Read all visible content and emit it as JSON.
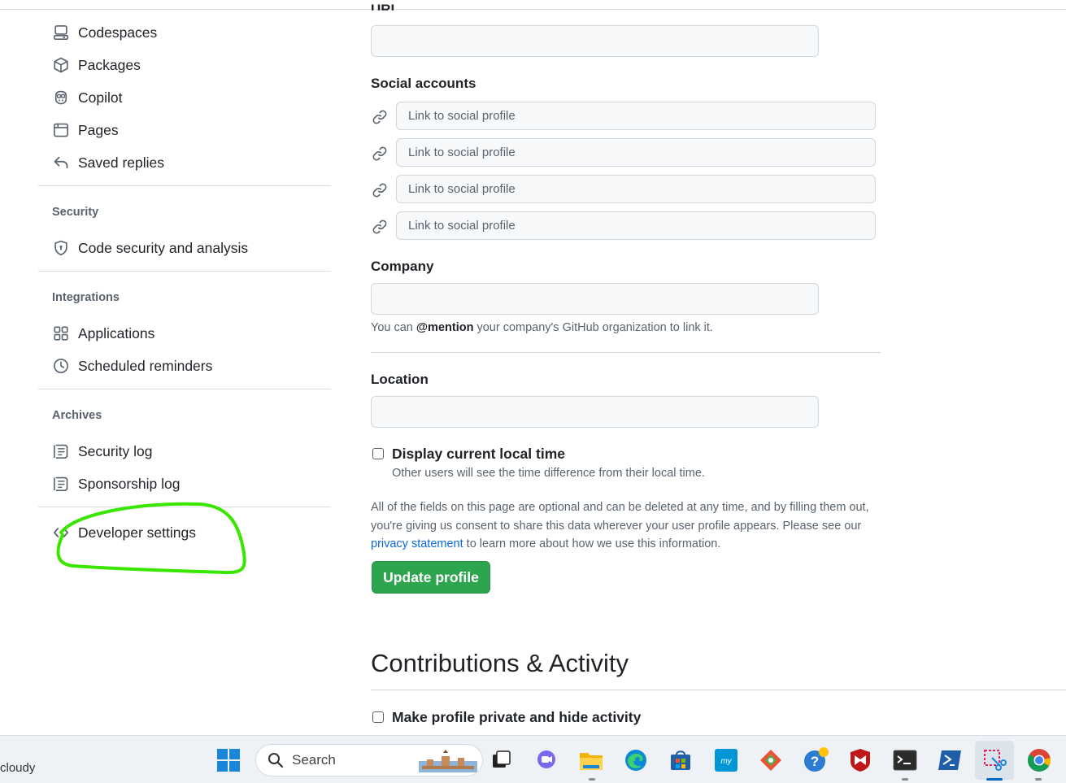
{
  "sidebar": {
    "items_top": [
      {
        "label": "Codespaces",
        "icon": "codespaces-icon"
      },
      {
        "label": "Packages",
        "icon": "package-icon"
      },
      {
        "label": "Copilot",
        "icon": "copilot-icon"
      },
      {
        "label": "Pages",
        "icon": "browser-icon"
      },
      {
        "label": "Saved replies",
        "icon": "reply-icon"
      }
    ],
    "security": {
      "title": "Security",
      "items": [
        {
          "label": "Code security and analysis",
          "icon": "shield-icon"
        }
      ]
    },
    "integrations": {
      "title": "Integrations",
      "items": [
        {
          "label": "Applications",
          "icon": "apps-icon"
        },
        {
          "label": "Scheduled reminders",
          "icon": "clock-icon"
        }
      ]
    },
    "archives": {
      "title": "Archives",
      "items": [
        {
          "label": "Security log",
          "icon": "log-icon"
        },
        {
          "label": "Sponsorship log",
          "icon": "log-icon"
        }
      ]
    },
    "developer_settings": {
      "label": "Developer settings",
      "icon": "code-icon"
    }
  },
  "form": {
    "url_label": "URL",
    "url_value": "",
    "social_label": "Social accounts",
    "social_placeholder": "Link to social profile",
    "company_label": "Company",
    "company_value": "",
    "company_note_prefix": "You can ",
    "company_note_mention": "@mention",
    "company_note_suffix": " your company's GitHub organization to link it.",
    "location_label": "Location",
    "location_value": "",
    "local_time_label": "Display current local time",
    "local_time_note": "Other users will see the time difference from their local time.",
    "consent_text_1": "All of the fields on this page are optional and can be deleted at any time, and by filling them out, you're giving us consent to share this data wherever your user profile appears. Please see our ",
    "privacy_link": "privacy statement",
    "consent_text_2": " to learn more about how we use this information.",
    "update_button": "Update profile"
  },
  "contributions": {
    "heading": "Contributions & Activity",
    "private_label": "Make profile private and hide activity"
  },
  "taskbar": {
    "weather": "cloudy",
    "search_label": "Search",
    "apps": [
      "start-icon",
      "task-view-icon",
      "chat-icon",
      "file-explorer-icon",
      "edge-icon",
      "store-icon",
      "myhp-icon",
      "git-icon",
      "help-icon",
      "mcafee-icon",
      "terminal-icon",
      "powershell-icon",
      "snipping-tool-icon",
      "chrome-icon"
    ]
  },
  "colors": {
    "accent_green": "#2da44e",
    "link_blue": "#0969da",
    "annotation_green": "#39e600"
  }
}
